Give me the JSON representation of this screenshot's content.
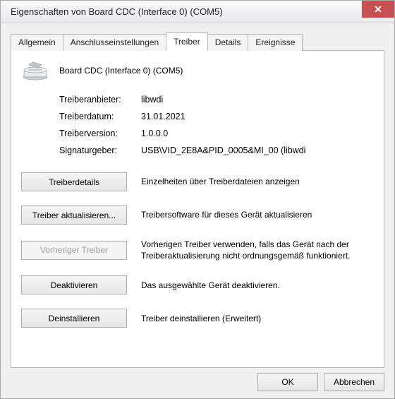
{
  "title": "Eigenschaften von Board CDC (Interface 0) (COM5)",
  "tabs": {
    "general": "Allgemein",
    "port": "Anschlusseinstellungen",
    "driver": "Treiber",
    "details": "Details",
    "events": "Ereignisse"
  },
  "device": {
    "name": "Board CDC (Interface 0) (COM5)"
  },
  "info": {
    "provider_label": "Treiberanbieter:",
    "provider_value": "libwdi",
    "date_label": "Treiberdatum:",
    "date_value": "31.01.2021",
    "version_label": "Treiberversion:",
    "version_value": "1.0.0.0",
    "signer_label": "Signaturgeber:",
    "signer_value": "USB\\VID_2E8A&PID_0005&MI_00 (libwdi"
  },
  "actions": {
    "details_btn": "Treiberdetails",
    "details_desc": "Einzelheiten über Treiberdateien anzeigen",
    "update_btn": "Treiber aktualisieren...",
    "update_desc": "Treibersoftware für dieses Gerät aktualisieren",
    "rollback_btn": "Vorheriger Treiber",
    "rollback_desc": "Vorherigen Treiber verwenden, falls das Gerät nach der Treiberaktualisierung nicht ordnungsgemäß funktioniert.",
    "disable_btn": "Deaktivieren",
    "disable_desc": "Das ausgewählte Gerät deaktivieren.",
    "uninstall_btn": "Deinstallieren",
    "uninstall_desc": "Treiber deinstallieren (Erweitert)"
  },
  "footer": {
    "ok": "OK",
    "cancel": "Abbrechen"
  }
}
